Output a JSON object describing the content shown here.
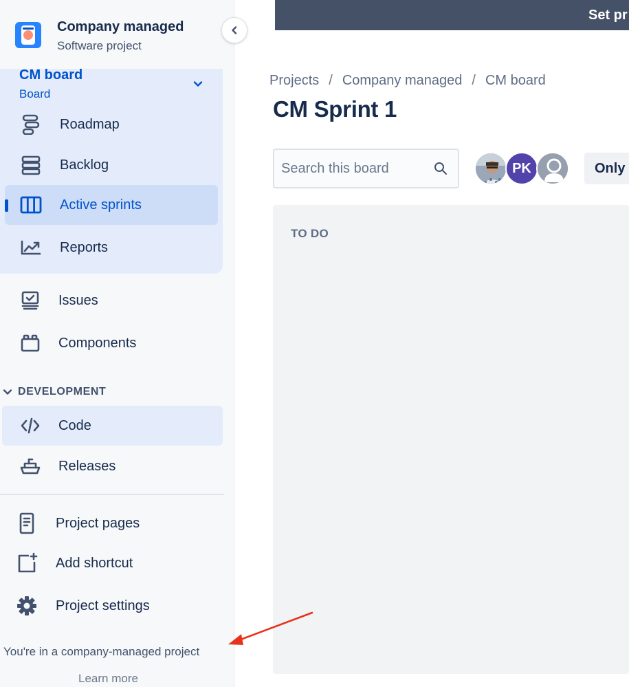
{
  "project": {
    "name": "Company managed",
    "type": "Software project"
  },
  "board": {
    "title": "CM board",
    "subtitle": "Board"
  },
  "sidebar": {
    "board_items": [
      {
        "label": "Roadmap",
        "icon": "roadmap-icon",
        "active": false
      },
      {
        "label": "Backlog",
        "icon": "backlog-icon",
        "active": false
      },
      {
        "label": "Active sprints",
        "icon": "columns-icon",
        "active": true
      },
      {
        "label": "Reports",
        "icon": "chart-line-icon",
        "active": false
      }
    ],
    "items": [
      {
        "label": "Issues",
        "icon": "issues-icon"
      },
      {
        "label": "Components",
        "icon": "components-icon"
      }
    ],
    "development_heading": "DEVELOPMENT",
    "development_items": [
      {
        "label": "Code",
        "icon": "code-icon"
      },
      {
        "label": "Releases",
        "icon": "ship-icon"
      }
    ],
    "bottom_items": [
      {
        "label": "Project pages",
        "icon": "page-icon"
      },
      {
        "label": "Add shortcut",
        "icon": "add-shortcut-icon"
      },
      {
        "label": "Project settings",
        "icon": "gear-icon"
      }
    ],
    "footer_text": "You're in a company-managed project",
    "footer_link": "Learn more"
  },
  "topbar": {
    "text": "Set pr"
  },
  "breadcrumb": [
    "Projects",
    "Company managed",
    "CM board"
  ],
  "page_title": "CM Sprint 1",
  "search": {
    "placeholder": "Search this board",
    "value": ""
  },
  "avatars": [
    {
      "kind": "photo"
    },
    {
      "initials": "PK",
      "color": "#5243aa"
    },
    {
      "kind": "default"
    }
  ],
  "filter_button": "Only",
  "columns": [
    {
      "title": "TO DO"
    }
  ],
  "colors": {
    "accent": "#0052cc",
    "active_bg": "#cddcf7",
    "group_bg": "#e4ecfb",
    "topbar": "#455166",
    "annotation_arrow": "#e8331c"
  }
}
